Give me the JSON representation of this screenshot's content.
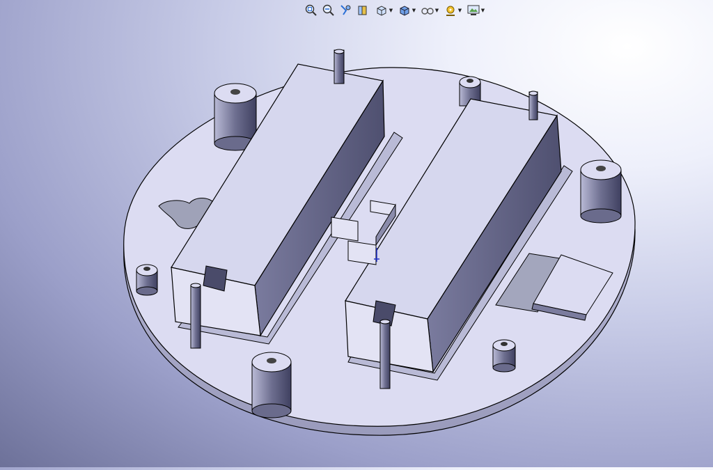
{
  "app": {
    "window_title": ""
  },
  "heads_up_toolbar": {
    "buttons": [
      {
        "id": "zoom-to-fit",
        "icon": "zoom-to-fit-icon",
        "has_dropdown": false
      },
      {
        "id": "zoom-to-area",
        "icon": "zoom-to-area-icon",
        "has_dropdown": false
      },
      {
        "id": "previous-view",
        "icon": "previous-view-icon",
        "has_dropdown": false
      },
      {
        "id": "section-view",
        "icon": "section-view-icon",
        "has_dropdown": false
      },
      {
        "id": "view-orientation",
        "icon": "view-orientation-icon",
        "has_dropdown": true
      },
      {
        "id": "display-style",
        "icon": "display-style-icon",
        "has_dropdown": true
      },
      {
        "id": "hide-show-items",
        "icon": "hide-show-items-icon",
        "has_dropdown": true
      },
      {
        "id": "edit-appearance",
        "icon": "edit-appearance-icon",
        "has_dropdown": true
      },
      {
        "id": "apply-scene",
        "icon": "apply-scene-icon",
        "has_dropdown": true
      }
    ]
  },
  "model": {
    "description_visible": false,
    "colors": {
      "face_top": "#dcdcf2",
      "face_light": "#c9c9e6",
      "face_dark": "#5f6080",
      "edge": "#000000",
      "background_light": "#ffffff",
      "background_dark": "#6d7199"
    }
  }
}
